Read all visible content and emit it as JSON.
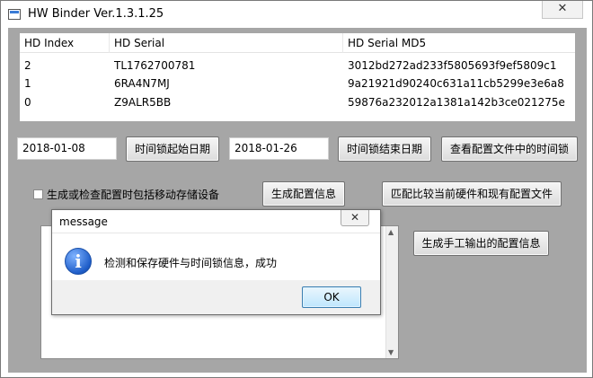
{
  "window": {
    "title": "HW Binder Ver.1.3.1.25",
    "close_glyph": "✕"
  },
  "grid": {
    "headers": [
      "HD Index",
      "HD Serial",
      "HD Serial MD5"
    ],
    "rows": [
      [
        "2",
        "TL1762700781",
        "3012bd272ad233f5805693f9ef5809c1"
      ],
      [
        "1",
        "6RA4N7MJ",
        "9a21921d90240c631a11cb5299e3e6a8"
      ],
      [
        "0",
        "Z9ALR5BB",
        "59876a232012a1381a142b3ce021275e"
      ]
    ]
  },
  "time_lock": {
    "start_date": "2018-01-08",
    "start_button": "时间锁起始日期",
    "end_date": "2018-01-26",
    "end_button": "时间锁结束日期",
    "view_button": "查看配置文件中的时间锁"
  },
  "options": {
    "include_removable_label": "生成或检查配置时包括移动存储设备",
    "include_removable_checked": false
  },
  "actions": {
    "generate_config": "生成配置信息",
    "match_compare": "匹配比较当前硬件和现有配置文件",
    "generate_manual": "生成手工输出的配置信息"
  },
  "dialog": {
    "title": "message",
    "close_glyph": "✕",
    "message": "检测和保存硬件与时间锁信息，成功",
    "ok": "OK",
    "icon": "info-icon"
  },
  "colors": {
    "client_background": "#a6a6a6",
    "ok_accent": "#3c7fb1"
  }
}
